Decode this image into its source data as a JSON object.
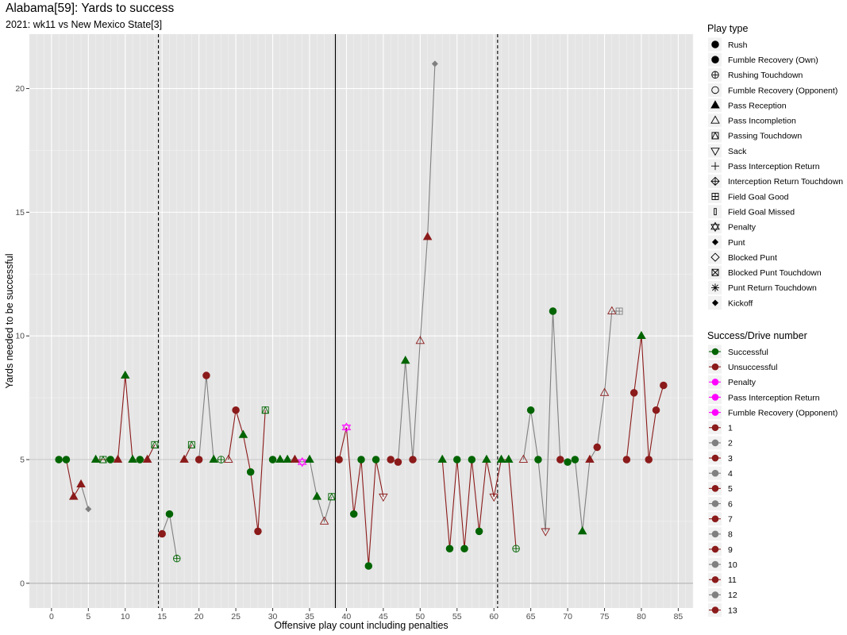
{
  "title": "Alabama[59]: Yards to success",
  "subtitle": "2021: wk11 vs New Mexico State[3]",
  "chart_data": {
    "type": "scatter",
    "title": "Alabama[59]: Yards to success",
    "subtitle": "2021: wk11 vs New Mexico State[3]",
    "xlabel": "Offensive play count including penalties",
    "ylabel": "Yards needed to be successful",
    "xlim": [
      -3,
      87
    ],
    "ylim": [
      -1,
      22.2
    ],
    "x_ticks": [
      0,
      5,
      10,
      15,
      20,
      25,
      30,
      35,
      40,
      45,
      50,
      55,
      60,
      65,
      70,
      75,
      80,
      85
    ],
    "y_ticks": [
      0,
      5,
      10,
      15,
      20
    ],
    "grid": true,
    "vlines": [
      {
        "x": 14.5,
        "style": "dashed"
      },
      {
        "x": 38.5,
        "style": "solid"
      },
      {
        "x": 60.5,
        "style": "dashed"
      }
    ],
    "legend_playtype": {
      "title": "Play type",
      "entries": [
        {
          "label": "Rush",
          "shape": "circle"
        },
        {
          "label": "Fumble Recovery (Own)",
          "shape": "circle"
        },
        {
          "label": "Rushing Touchdown",
          "shape": "circle-plus"
        },
        {
          "label": "Fumble Recovery (Opponent)",
          "shape": "circle-open"
        },
        {
          "label": "Pass Reception",
          "shape": "triangle"
        },
        {
          "label": "Pass Incompletion",
          "shape": "triangle-open"
        },
        {
          "label": "Passing Touchdown",
          "shape": "square-triangle"
        },
        {
          "label": "Sack",
          "shape": "triangle-down-open"
        },
        {
          "label": "Pass Interception Return",
          "shape": "plus"
        },
        {
          "label": "Interception Return Touchdown",
          "shape": "diamond-plus"
        },
        {
          "label": "Field Goal Good",
          "shape": "square-plus"
        },
        {
          "label": "Field Goal Missed",
          "shape": "bar"
        },
        {
          "label": "Penalty",
          "shape": "star-david"
        },
        {
          "label": "Punt",
          "shape": "diamond"
        },
        {
          "label": "Blocked Punt",
          "shape": "diamond-open"
        },
        {
          "label": "Blocked Punt Touchdown",
          "shape": "square-cross"
        },
        {
          "label": "Punt Return Touchdown",
          "shape": "asterisk"
        },
        {
          "label": "Kickoff",
          "shape": "diamond"
        }
      ]
    },
    "legend_success": {
      "title": "Success/Drive number",
      "entries": [
        {
          "label": "Successful",
          "color": "#006400"
        },
        {
          "label": "Unsuccessful",
          "color": "#8b1a1a"
        },
        {
          "label": "Penalty",
          "color": "#ff00ff"
        },
        {
          "label": "Pass Interception Return",
          "color": "#ff00ff"
        },
        {
          "label": "Fumble Recovery (Opponent)",
          "color": "#ff00ff"
        },
        {
          "label": "1",
          "color": "#8b1a1a"
        },
        {
          "label": "2",
          "color": "#808080"
        },
        {
          "label": "3",
          "color": "#8b1a1a"
        },
        {
          "label": "4",
          "color": "#808080"
        },
        {
          "label": "5",
          "color": "#8b1a1a"
        },
        {
          "label": "6",
          "color": "#808080"
        },
        {
          "label": "7",
          "color": "#8b1a1a"
        },
        {
          "label": "8",
          "color": "#808080"
        },
        {
          "label": "9",
          "color": "#8b1a1a"
        },
        {
          "label": "10",
          "color": "#808080"
        },
        {
          "label": "11",
          "color": "#8b1a1a"
        },
        {
          "label": "12",
          "color": "#808080"
        },
        {
          "label": "13",
          "color": "#8b1a1a"
        }
      ]
    },
    "colors": {
      "successful": "#006400",
      "unsuccessful": "#8b1a1a",
      "penalty": "#ff00ff",
      "drive_odd": "#8b1a1a",
      "drive_even": "#808080"
    },
    "drives": [
      {
        "drive": 1,
        "points": [
          {
            "x": 1,
            "y": 5,
            "s": "circle",
            "c": "S"
          },
          {
            "x": 2,
            "y": 5,
            "s": "circle",
            "c": "S"
          },
          {
            "x": 3,
            "y": 3.5,
            "s": "triangle",
            "c": "U"
          },
          {
            "x": 4,
            "y": 4,
            "s": "triangle",
            "c": "U"
          }
        ]
      },
      {
        "drive": 2,
        "points": [
          {
            "x": 4,
            "y": 4,
            "s": "none",
            "c": "U"
          },
          {
            "x": 5,
            "y": 3,
            "s": "diamond",
            "c": "G"
          }
        ]
      },
      {
        "drive": 3,
        "points": [
          {
            "x": 6,
            "y": 5,
            "s": "triangle",
            "c": "S"
          },
          {
            "x": 7,
            "y": 5,
            "s": "square-triangle",
            "c": "S"
          },
          {
            "x": 8,
            "y": 5,
            "s": "circle",
            "c": "S"
          },
          {
            "x": 9,
            "y": 5,
            "s": "triangle",
            "c": "U"
          },
          {
            "x": 10,
            "y": 8.4,
            "s": "triangle",
            "c": "S"
          },
          {
            "x": 11,
            "y": 5,
            "s": "triangle",
            "c": "S"
          },
          {
            "x": 12,
            "y": 5,
            "s": "circle",
            "c": "S"
          },
          {
            "x": 13,
            "y": 5,
            "s": "triangle",
            "c": "U"
          },
          {
            "x": 14,
            "y": 5.6,
            "s": "square-triangle",
            "c": "S"
          }
        ]
      },
      {
        "drive": 4,
        "points": [
          {
            "x": 15,
            "y": 2,
            "s": "circle",
            "c": "U"
          },
          {
            "x": 16,
            "y": 2.8,
            "s": "circle",
            "c": "S"
          },
          {
            "x": 17,
            "y": 1,
            "s": "circle-plus",
            "c": "S"
          }
        ]
      },
      {
        "drive": 5,
        "points": [
          {
            "x": 18,
            "y": 5,
            "s": "triangle",
            "c": "U"
          },
          {
            "x": 19,
            "y": 5.6,
            "s": "square-triangle",
            "c": "S"
          }
        ]
      },
      {
        "drive": 6,
        "points": [
          {
            "x": 20,
            "y": 5,
            "s": "circle",
            "c": "U"
          },
          {
            "x": 21,
            "y": 8.4,
            "s": "circle",
            "c": "U"
          },
          {
            "x": 22,
            "y": 5,
            "s": "triangle",
            "c": "S"
          },
          {
            "x": 23,
            "y": 5,
            "s": "circle-plus",
            "c": "S"
          }
        ]
      },
      {
        "drive": 7,
        "points": [
          {
            "x": 24,
            "y": 5,
            "s": "triangle-open",
            "c": "U"
          },
          {
            "x": 25,
            "y": 7,
            "s": "circle",
            "c": "U"
          },
          {
            "x": 26,
            "y": 6,
            "s": "triangle",
            "c": "S"
          },
          {
            "x": 27,
            "y": 4.5,
            "s": "circle",
            "c": "S"
          },
          {
            "x": 28,
            "y": 2.1,
            "s": "circle",
            "c": "U"
          },
          {
            "x": 29,
            "y": 7,
            "s": "square-triangle",
            "c": "S"
          }
        ]
      },
      {
        "drive": 8,
        "points": [
          {
            "x": 30,
            "y": 5,
            "s": "circle",
            "c": "S"
          },
          {
            "x": 31,
            "y": 5,
            "s": "triangle",
            "c": "S"
          },
          {
            "x": 32,
            "y": 5,
            "s": "triangle",
            "c": "S"
          },
          {
            "x": 33,
            "y": 5,
            "s": "triangle",
            "c": "U"
          },
          {
            "x": 34,
            "y": 4.9,
            "s": "star-david",
            "c": "P"
          },
          {
            "x": 35,
            "y": 5,
            "s": "triangle",
            "c": "S"
          },
          {
            "x": 36,
            "y": 3.5,
            "s": "triangle",
            "c": "S"
          },
          {
            "x": 37,
            "y": 2.5,
            "s": "triangle-open",
            "c": "U"
          },
          {
            "x": 38,
            "y": 3.5,
            "s": "square-triangle",
            "c": "S"
          }
        ]
      },
      {
        "drive": 9,
        "points": [
          {
            "x": 39,
            "y": 5,
            "s": "circle",
            "c": "U"
          },
          {
            "x": 40,
            "y": 6.3,
            "s": "star-david",
            "c": "P"
          },
          {
            "x": 41,
            "y": 2.8,
            "s": "circle",
            "c": "S"
          },
          {
            "x": 42,
            "y": 5,
            "s": "circle",
            "c": "S"
          },
          {
            "x": 43,
            "y": 0.7,
            "s": "circle",
            "c": "S"
          },
          {
            "x": 44,
            "y": 5,
            "s": "circle",
            "c": "S"
          },
          {
            "x": 45,
            "y": 3.5,
            "s": "triangle-down-open",
            "c": "U"
          }
        ]
      },
      {
        "drive": 10,
        "points": [
          {
            "x": 46,
            "y": 5,
            "s": "circle",
            "c": "U"
          },
          {
            "x": 47,
            "y": 4.9,
            "s": "circle",
            "c": "U"
          },
          {
            "x": 48,
            "y": 9,
            "s": "triangle",
            "c": "S"
          },
          {
            "x": 49,
            "y": 5,
            "s": "circle",
            "c": "U"
          },
          {
            "x": 50,
            "y": 9.8,
            "s": "triangle-open",
            "c": "U"
          },
          {
            "x": 51,
            "y": 14,
            "s": "triangle",
            "c": "U"
          },
          {
            "x": 52,
            "y": 21,
            "s": "diamond",
            "c": "G"
          }
        ]
      },
      {
        "drive": 11,
        "points": [
          {
            "x": 53,
            "y": 5,
            "s": "triangle",
            "c": "S"
          },
          {
            "x": 54,
            "y": 1.4,
            "s": "circle",
            "c": "S"
          },
          {
            "x": 55,
            "y": 5,
            "s": "circle",
            "c": "S"
          },
          {
            "x": 56,
            "y": 1.4,
            "s": "circle",
            "c": "S"
          },
          {
            "x": 57,
            "y": 5,
            "s": "circle",
            "c": "S"
          },
          {
            "x": 58,
            "y": 2.1,
            "s": "circle",
            "c": "S"
          },
          {
            "x": 59,
            "y": 5,
            "s": "triangle",
            "c": "S"
          },
          {
            "x": 60,
            "y": 3.5,
            "s": "triangle-down-open",
            "c": "U"
          },
          {
            "x": 61,
            "y": 5,
            "s": "triangle",
            "c": "S"
          },
          {
            "x": 62,
            "y": 5,
            "s": "triangle",
            "c": "S"
          },
          {
            "x": 63,
            "y": 1.4,
            "s": "circle-plus",
            "c": "S"
          }
        ]
      },
      {
        "drive": 12,
        "points": [
          {
            "x": 64,
            "y": 5,
            "s": "triangle-open",
            "c": "U"
          },
          {
            "x": 65,
            "y": 7,
            "s": "circle",
            "c": "S"
          },
          {
            "x": 66,
            "y": 5,
            "s": "circle",
            "c": "S"
          },
          {
            "x": 67,
            "y": 2.1,
            "s": "triangle-down-open",
            "c": "U"
          },
          {
            "x": 68,
            "y": 11,
            "s": "circle",
            "c": "S"
          },
          {
            "x": 69,
            "y": 5,
            "s": "circle",
            "c": "U"
          },
          {
            "x": 70,
            "y": 4.9,
            "s": "circle",
            "c": "S"
          },
          {
            "x": 71,
            "y": 5,
            "s": "circle",
            "c": "S"
          },
          {
            "x": 72,
            "y": 2.1,
            "s": "triangle",
            "c": "S"
          },
          {
            "x": 73,
            "y": 5,
            "s": "triangle",
            "c": "U"
          },
          {
            "x": 74,
            "y": 5.5,
            "s": "circle",
            "c": "U"
          },
          {
            "x": 75,
            "y": 7.7,
            "s": "triangle-open",
            "c": "U"
          },
          {
            "x": 76,
            "y": 11,
            "s": "triangle-open",
            "c": "U"
          },
          {
            "x": 77,
            "y": 11,
            "s": "square-plus",
            "c": "G"
          }
        ]
      },
      {
        "drive": 13,
        "points": [
          {
            "x": 78,
            "y": 5,
            "s": "circle",
            "c": "U"
          },
          {
            "x": 79,
            "y": 7.7,
            "s": "circle",
            "c": "U"
          },
          {
            "x": 80,
            "y": 10,
            "s": "triangle",
            "c": "S"
          },
          {
            "x": 81,
            "y": 5,
            "s": "circle",
            "c": "U"
          },
          {
            "x": 82,
            "y": 7,
            "s": "circle",
            "c": "U"
          },
          {
            "x": 83,
            "y": 8,
            "s": "circle",
            "c": "U"
          }
        ]
      }
    ]
  }
}
